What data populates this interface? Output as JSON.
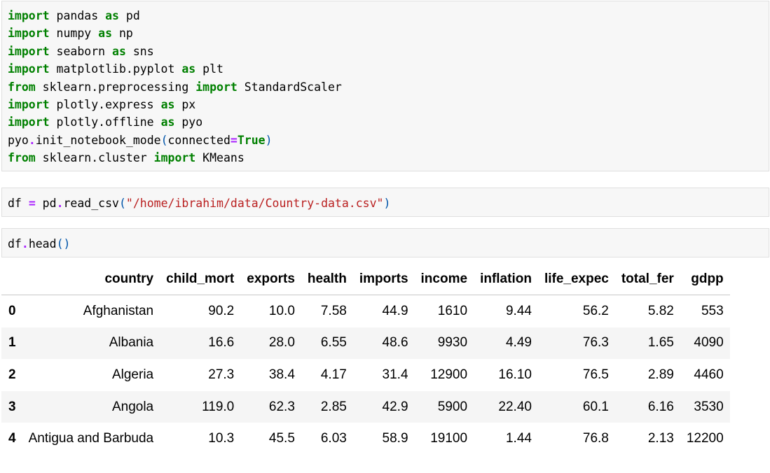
{
  "cells": {
    "imports": {
      "lines": [
        [
          [
            "kw",
            "import"
          ],
          [
            "t",
            " pandas "
          ],
          [
            "kw",
            "as"
          ],
          [
            "t",
            " pd"
          ]
        ],
        [
          [
            "kw",
            "import"
          ],
          [
            "t",
            " numpy "
          ],
          [
            "kw",
            "as"
          ],
          [
            "t",
            " np"
          ]
        ],
        [
          [
            "kw",
            "import"
          ],
          [
            "t",
            " seaborn "
          ],
          [
            "kw",
            "as"
          ],
          [
            "t",
            " sns"
          ]
        ],
        [
          [
            "kw",
            "import"
          ],
          [
            "t",
            " matplotlib.pyplot "
          ],
          [
            "kw",
            "as"
          ],
          [
            "t",
            " plt"
          ]
        ],
        [
          [
            "kw",
            "from"
          ],
          [
            "t",
            " sklearn.preprocessing "
          ],
          [
            "kw",
            "import"
          ],
          [
            "t",
            " StandardScaler"
          ]
        ],
        [
          [
            "kw",
            "import"
          ],
          [
            "t",
            " plotly.express "
          ],
          [
            "kw",
            "as"
          ],
          [
            "t",
            " px"
          ]
        ],
        [
          [
            "kw",
            "import"
          ],
          [
            "t",
            " plotly.offline "
          ],
          [
            "kw",
            "as"
          ],
          [
            "t",
            " pyo"
          ]
        ],
        [
          [
            "t",
            "pyo"
          ],
          [
            "op",
            "."
          ],
          [
            "t",
            "init_notebook_mode"
          ],
          [
            "br",
            "("
          ],
          [
            "t",
            "connected"
          ],
          [
            "op",
            "="
          ],
          [
            "kw",
            "True"
          ],
          [
            "br",
            ")"
          ]
        ],
        [
          [
            "kw",
            "from"
          ],
          [
            "t",
            " sklearn.cluster "
          ],
          [
            "kw",
            "import"
          ],
          [
            "t",
            " KMeans"
          ]
        ]
      ]
    },
    "read_csv": {
      "lines": [
        [
          [
            "t",
            "df "
          ],
          [
            "op",
            "="
          ],
          [
            "t",
            " pd"
          ],
          [
            "op",
            "."
          ],
          [
            "t",
            "read_csv"
          ],
          [
            "br",
            "("
          ],
          [
            "str",
            "\"/home/ibrahim/data/Country-data.csv\""
          ],
          [
            "br",
            ")"
          ]
        ]
      ]
    },
    "head": {
      "lines": [
        [
          [
            "t",
            "df"
          ],
          [
            "op",
            "."
          ],
          [
            "t",
            "head"
          ],
          [
            "br",
            "()"
          ]
        ]
      ]
    }
  },
  "dataframe": {
    "columns": [
      "country",
      "child_mort",
      "exports",
      "health",
      "imports",
      "income",
      "inflation",
      "life_expec",
      "total_fer",
      "gdpp"
    ],
    "rows": [
      {
        "index": "0",
        "cells": [
          "Afghanistan",
          "90.2",
          "10.0",
          "7.58",
          "44.9",
          "1610",
          "9.44",
          "56.2",
          "5.82",
          "553"
        ]
      },
      {
        "index": "1",
        "cells": [
          "Albania",
          "16.6",
          "28.0",
          "6.55",
          "48.6",
          "9930",
          "4.49",
          "76.3",
          "1.65",
          "4090"
        ]
      },
      {
        "index": "2",
        "cells": [
          "Algeria",
          "27.3",
          "38.4",
          "4.17",
          "31.4",
          "12900",
          "16.10",
          "76.5",
          "2.89",
          "4460"
        ]
      },
      {
        "index": "3",
        "cells": [
          "Angola",
          "119.0",
          "62.3",
          "2.85",
          "42.9",
          "5900",
          "22.40",
          "60.1",
          "6.16",
          "3530"
        ]
      },
      {
        "index": "4",
        "cells": [
          "Antigua and Barbuda",
          "10.3",
          "45.5",
          "6.03",
          "58.9",
          "19100",
          "1.44",
          "76.8",
          "2.13",
          "12200"
        ]
      }
    ]
  }
}
